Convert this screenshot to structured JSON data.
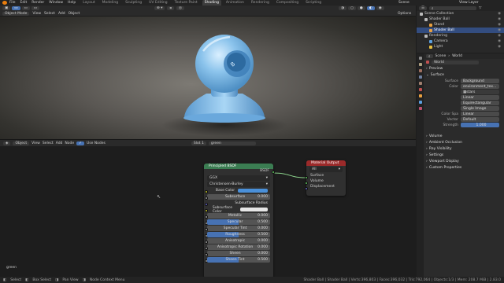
{
  "menus": [
    "File",
    "Edit",
    "Render",
    "Window",
    "Help"
  ],
  "workspaces": [
    "Layout",
    "Modeling",
    "Sculpting",
    "UV Editing",
    "Texture Paint",
    "Shading",
    "Animation",
    "Rendering",
    "Compositing",
    "Scripting"
  ],
  "active_workspace": "Shading",
  "scene": "Scene",
  "view_layer": "View Layer",
  "viewport": {
    "mode": "Object Mode",
    "menus": [
      "View",
      "Select",
      "Add",
      "Object"
    ],
    "options": "Options"
  },
  "node_editor": {
    "editor_type": "Object",
    "menus": [
      "View",
      "Select",
      "Add",
      "Node"
    ],
    "use_nodes": "Use Nodes",
    "slot": "Slot 1",
    "material": "green",
    "material_label": "green"
  },
  "bsdf_node": {
    "title": "Principled BSDF",
    "output": "BSDF",
    "distribution": "GGX",
    "subsurface_method": "Christensen-Burley",
    "props": [
      {
        "label": "Base Color",
        "value": ""
      },
      {
        "label": "Subsurface",
        "value": "0.000",
        "fill": 0
      },
      {
        "label": "Subsurface Radius",
        "value": ""
      },
      {
        "label": "Subsurface Color",
        "value": ""
      },
      {
        "label": "Metallic",
        "value": "0.000",
        "fill": 0
      },
      {
        "label": "Specular",
        "value": "0.500",
        "fill": 0.5
      },
      {
        "label": "Specular Tint",
        "value": "0.000",
        "fill": 0
      },
      {
        "label": "Roughness",
        "value": "0.500",
        "fill": 0.5
      },
      {
        "label": "Anisotropic",
        "value": "0.000",
        "fill": 0
      },
      {
        "label": "Anisotropic Rotation",
        "value": "0.000",
        "fill": 0
      },
      {
        "label": "Sheen",
        "value": "0.000",
        "fill": 0
      },
      {
        "label": "Sheen Tint",
        "value": "0.500",
        "fill": 0.5
      }
    ],
    "base_color": "#4a90d9",
    "subsurface_color": "#e6e6e6"
  },
  "output_node": {
    "title": "Material Output",
    "target": "All",
    "sockets": [
      "Surface",
      "Volume",
      "Displacement"
    ]
  },
  "outliner": {
    "items": [
      {
        "label": "Scene Collection",
        "indent": 0,
        "selected": false,
        "color": "#bbbbbb"
      },
      {
        "label": "Shader Ball",
        "indent": 1,
        "selected": false,
        "color": "#bbbbbb"
      },
      {
        "label": "Stand",
        "indent": 2,
        "selected": false,
        "color": "#e8a040"
      },
      {
        "label": "Shader Ball",
        "indent": 2,
        "selected": true,
        "color": "#e8a040"
      },
      {
        "label": "Rendering",
        "indent": 1,
        "selected": false,
        "color": "#bbbbbb"
      },
      {
        "label": "Camera",
        "indent": 2,
        "selected": false,
        "color": "#5ca0e0"
      },
      {
        "label": "Light",
        "indent": 2,
        "selected": false,
        "color": "#e8c040"
      }
    ]
  },
  "properties": {
    "breadcrumb_scene": "Scene",
    "breadcrumb_world": "World",
    "world_name": "World",
    "sections_top": [
      "Preview",
      "Surface"
    ],
    "surface_label": "Surface",
    "surface_value": "Background",
    "color_label": "Color",
    "color_value": "environment_tex...",
    "image_name": "stars",
    "fields": [
      {
        "label": "",
        "value": "Linear"
      },
      {
        "label": "",
        "value": "Equirectangular"
      },
      {
        "label": "",
        "value": "Single Image"
      }
    ],
    "color_space_label": "Color Spa",
    "color_space_value": "Linear",
    "vector_label": "Vector",
    "vector_value": "Default",
    "strength_label": "Strength",
    "strength_value": "1.000",
    "sections_bottom": [
      "Volume",
      "Ambient Occlusion",
      "Ray Visibility",
      "Settings",
      "Viewport Display",
      "Custom Properties"
    ]
  },
  "statusbar": {
    "items": [
      "Select",
      "Box Select",
      "Pan View",
      "Node Context Menu"
    ],
    "stats": "Shader Ball | Shader Ball | Verts:396,803 | Faces:396,032 | Tris:792,064 | Objects:1/3 | Mem: 208.7 MiB | 2.83.0"
  },
  "colors": {
    "accent": "#4772b3",
    "bsdf_header": "#3b7d52",
    "output_header": "#9b2a2a",
    "ball": "#8cc4ec"
  }
}
